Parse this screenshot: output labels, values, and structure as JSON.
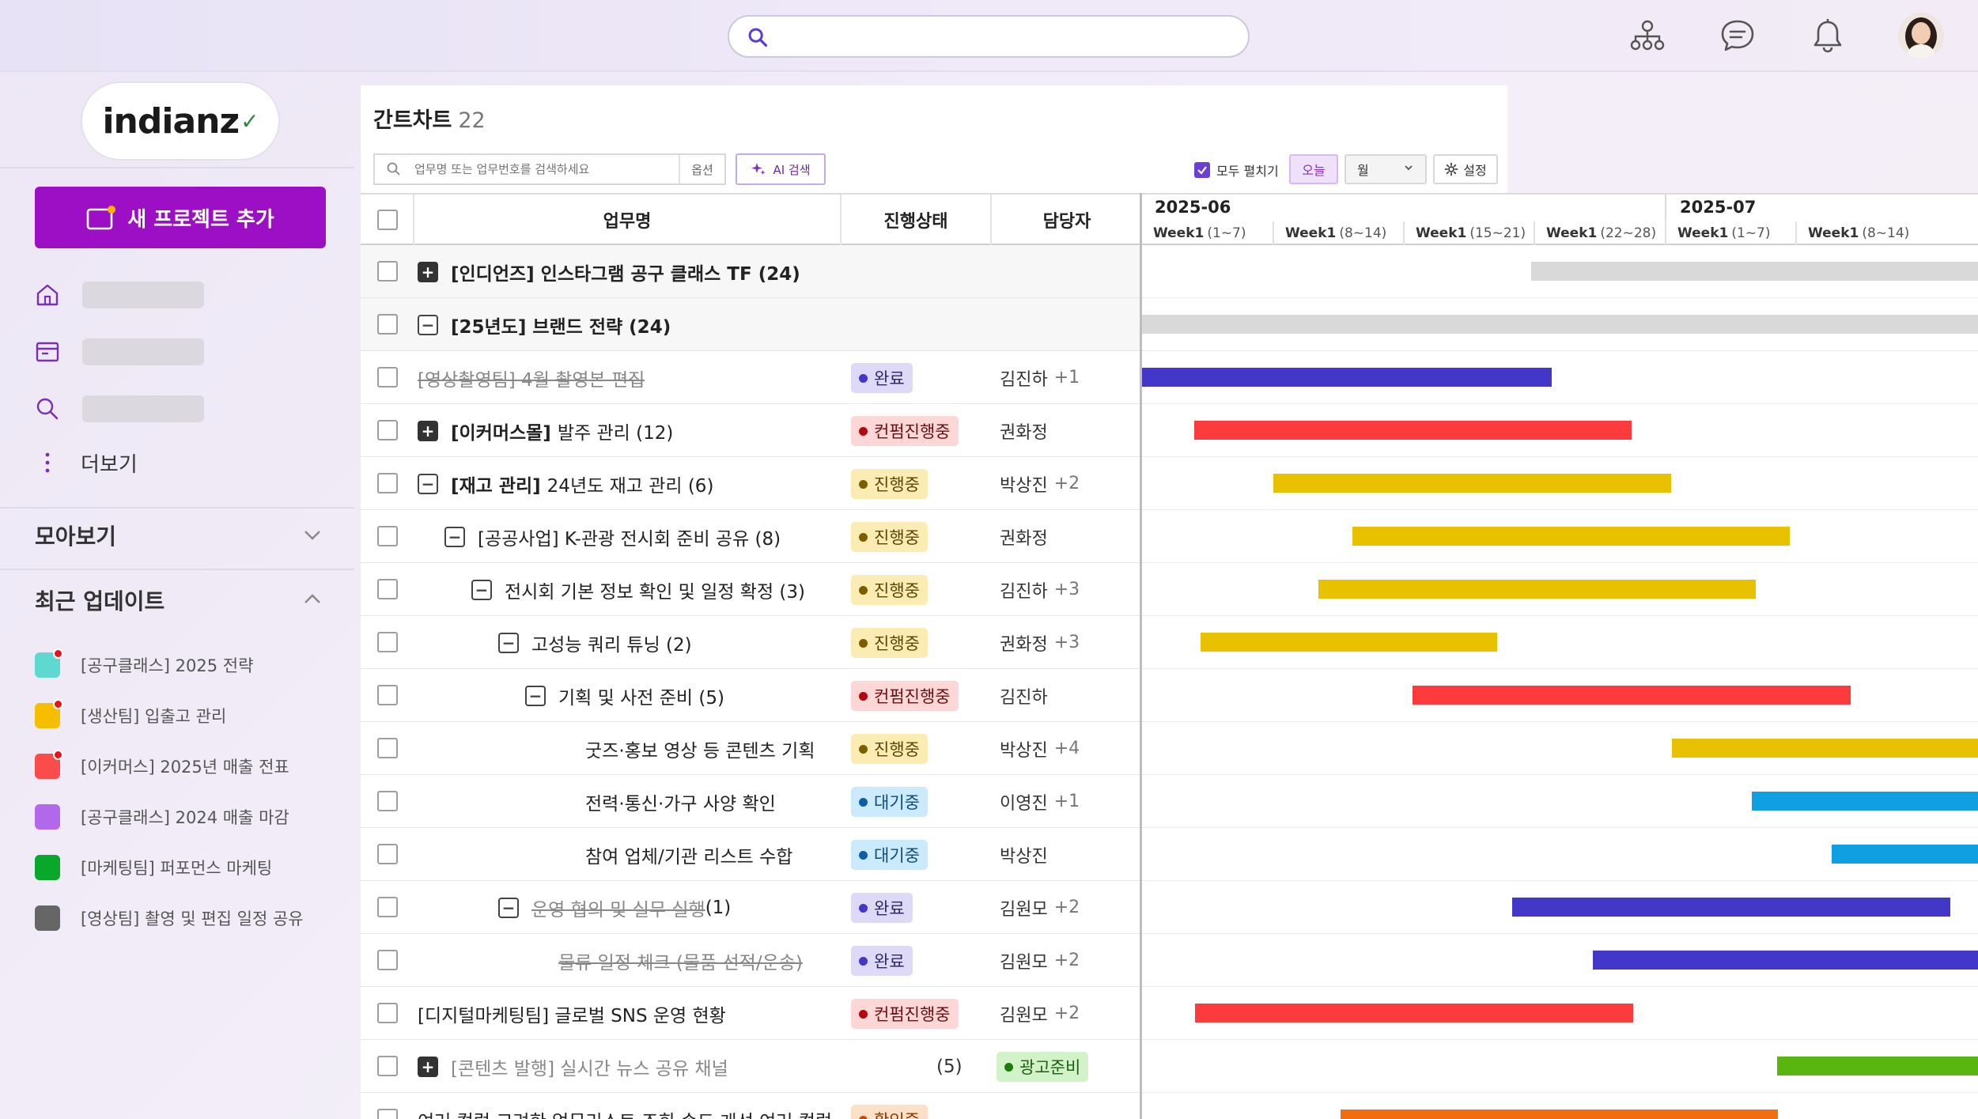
{
  "topbar": {
    "search_placeholder": "",
    "icons": [
      "search-icon",
      "org-chart-icon",
      "chat-icon",
      "bell-icon"
    ]
  },
  "sidebar": {
    "logo_text": "indianz",
    "new_project_label": "새 프로젝트 추가",
    "more_label": "더보기",
    "collect_label": "모아보기",
    "recent_label": "최근 업데이트",
    "recent_items": [
      {
        "label": "[공구클래스] 2025 전략",
        "color": "#5fd9cf",
        "badge": true
      },
      {
        "label": "[생산팀] 입출고 관리",
        "color": "#f5bf00",
        "badge": true
      },
      {
        "label": "[이커머스] 2025년 매출 전표",
        "color": "#fb4c4c",
        "badge": true
      },
      {
        "label": "[공구클래스] 2024 매출 마감",
        "color": "#b168ea",
        "badge": false
      },
      {
        "label": "[마케팅팀] 퍼포먼스 마케팅",
        "color": "#09a72a",
        "badge": false
      },
      {
        "label": "[영상팀] 촬영 및 편집 일정 공유",
        "color": "#666666",
        "badge": false
      }
    ]
  },
  "main": {
    "title": "간트차트",
    "count": "22",
    "filter_placeholder": "업무명 또는 업무번호를 검색하세요",
    "option_label": "옵션",
    "ai_label": "AI 검색",
    "expand_all_label": "모두 펼치기",
    "today_label": "오늘",
    "month_label": "월",
    "settings_label": "설정",
    "columns": {
      "name": "업무명",
      "status": "진행상태",
      "owner": "담당자"
    }
  },
  "rows": [
    {
      "indent": 0,
      "toggle": "+",
      "toggle_dark": true,
      "prefix": "[인디언즈]",
      "name": "인스타그램 공구 클래스 TF (24)",
      "bold_all": true,
      "group": true,
      "status": "",
      "owner": "",
      "extra": ""
    },
    {
      "indent": 0,
      "toggle": "−",
      "toggle_dark": false,
      "prefix": "[25년도]",
      "name": "브랜드 전략 (24)",
      "bold_all": true,
      "group": true,
      "status": "",
      "owner": "",
      "extra": ""
    },
    {
      "indent": 0,
      "toggle": "",
      "prefix": "",
      "name": "[영상촬영팀] 4월 촬영본 편집",
      "strike": true,
      "status": "완료",
      "owner": "김진하",
      "extra": "+1"
    },
    {
      "indent": 0,
      "toggle": "+",
      "toggle_dark": true,
      "prefix": "[이커머스몰]",
      "name": "발주 관리 (12)",
      "status": "컨펌진행중",
      "owner": "권화정",
      "extra": ""
    },
    {
      "indent": 0,
      "toggle": "−",
      "toggle_dark": false,
      "prefix": "[재고 관리]",
      "name": "24년도 재고 관리 (6)",
      "status": "진행중",
      "owner": "박상진",
      "extra": "+2"
    },
    {
      "indent": 1,
      "toggle": "−",
      "toggle_dark": false,
      "prefix": "",
      "name": "[공공사업] K-관광 전시회 준비 공유 (8)",
      "status": "진행중",
      "owner": "권화정",
      "extra": ""
    },
    {
      "indent": 2,
      "toggle": "−",
      "toggle_dark": false,
      "prefix": "",
      "name": "전시회 기본 정보 확인 및 일정 확정 (3)",
      "status": "진행중",
      "owner": "김진하",
      "extra": "+3"
    },
    {
      "indent": 3,
      "toggle": "−",
      "toggle_dark": false,
      "prefix": "",
      "name": "고성능 쿼리 튜닝 (2)",
      "status": "진행중",
      "owner": "권화정",
      "extra": "+3"
    },
    {
      "indent": 4,
      "toggle": "−",
      "toggle_dark": false,
      "prefix": "",
      "name": "기획 및 사전 준비 (5)",
      "status": "컨펌진행중",
      "owner": "김진하",
      "extra": ""
    },
    {
      "indent": 5,
      "toggle": "",
      "prefix": "",
      "name": "굿즈·홍보 영상 등 콘텐츠 기획",
      "status": "진행중",
      "owner": "박상진",
      "extra": "+4"
    },
    {
      "indent": 5,
      "toggle": "",
      "prefix": "",
      "name": "전력·통신·가구 사양 확인",
      "status": "대기중",
      "owner": "이영진",
      "extra": "+1"
    },
    {
      "indent": 5,
      "toggle": "",
      "prefix": "",
      "name": "참여 업체/기관 리스트 수합",
      "status": "대기중",
      "owner": "박상진",
      "extra": ""
    },
    {
      "indent": 3,
      "toggle": "−",
      "toggle_dark": false,
      "prefix": "",
      "name": "운영 협의 및 실무 실행",
      "name_tail": " (1)",
      "strike_part": true,
      "status": "완료",
      "owner": "김원모",
      "extra": "+2"
    },
    {
      "indent": 4,
      "toggle": "",
      "prefix": "",
      "name": "물류 일정 체크 (물품 선적/운송)",
      "strike": true,
      "status": "완료",
      "owner": "김원모",
      "extra": "+2"
    },
    {
      "indent": 0,
      "toggle": "",
      "prefix": "",
      "name": "[디지털마케팅팀] 글로벌 SNS 운영 현황",
      "status": "컨펌진행중",
      "owner": "김원모",
      "extra": "+2"
    },
    {
      "indent": 0,
      "toggle": "+",
      "toggle_dark": true,
      "prefix": "",
      "name": "[콘텐츠 발행] 실시간 뉴스 공유 채널",
      "grey": true,
      "count": "(5)",
      "status": "광고준비",
      "owner": "",
      "extra": ""
    },
    {
      "indent": 0,
      "toggle": "",
      "prefix": "",
      "name": "여러 컬럼 고려한 업무리스트 조회 속도 개선 여러 컬럼 고려한 업무리스…",
      "status": "확인중",
      "owner": "",
      "extra": ""
    }
  ],
  "status_styles": {
    "완료": {
      "bg": "#ded9f6",
      "dot": "#4237c9",
      "fg": "#2a2a6a"
    },
    "컨펌진행중": {
      "bg": "#fdd6d6",
      "dot": "#b5050f",
      "fg": "#6a1010"
    },
    "진행중": {
      "bg": "#fbecb4",
      "dot": "#7a5e00",
      "fg": "#5a4600"
    },
    "대기중": {
      "bg": "#cbeafb",
      "dot": "#0c5fa6",
      "fg": "#0c4a80"
    },
    "광고준비": {
      "bg": "#d2f3c7",
      "dot": "#1c7b0c",
      "fg": "#1e5e12"
    },
    "확인중": {
      "bg": "#fde0c8",
      "dot": "#c14b00",
      "fg": "#8a3b00"
    }
  },
  "gantt": {
    "months": [
      {
        "label": "2025-06"
      },
      {
        "label": "2025-07"
      }
    ],
    "weeks": [
      {
        "label": "Week1",
        "range": "(1~7)"
      },
      {
        "label": "Week1",
        "range": "(8~14)"
      },
      {
        "label": "Week1",
        "range": "(15~21)"
      },
      {
        "label": "Week1",
        "range": "(22~28)"
      },
      {
        "label": "Week1",
        "range": "(1~7)"
      },
      {
        "label": "Week1",
        "range": "(8~14)"
      }
    ],
    "bar_colors": {
      "grey": "#d9d9d9",
      "done": "#4237c9",
      "confirm": "#fd3a3c",
      "progress": "#e8c200",
      "wait": "#10a0e1",
      "ad": "#58b60f",
      "check": "#f26c10"
    },
    "bars": [
      {
        "color": "grey",
        "start": 0.465,
        "end": 1.0
      },
      {
        "color": "grey",
        "start": 0.0,
        "end": 1.0
      },
      {
        "color": "done",
        "start": 0.0,
        "end": 0.49
      },
      {
        "color": "confirm",
        "start": 0.062,
        "end": 0.585
      },
      {
        "color": "progress",
        "start": 0.157,
        "end": 0.633
      },
      {
        "color": "progress",
        "start": 0.252,
        "end": 0.775
      },
      {
        "color": "progress",
        "start": 0.211,
        "end": 0.734
      },
      {
        "color": "progress",
        "start": 0.07,
        "end": 0.425
      },
      {
        "color": "confirm",
        "start": 0.324,
        "end": 0.848
      },
      {
        "color": "progress",
        "start": 0.634,
        "end": 1.0
      },
      {
        "color": "wait",
        "start": 0.729,
        "end": 1.0
      },
      {
        "color": "wait",
        "start": 0.825,
        "end": 1.0
      },
      {
        "color": "done",
        "start": 0.443,
        "end": 0.967
      },
      {
        "color": "done",
        "start": 0.539,
        "end": 1.0
      },
      {
        "color": "confirm",
        "start": 0.063,
        "end": 0.587
      },
      {
        "color": "ad",
        "start": 0.76,
        "end": 1.0
      },
      {
        "color": "check",
        "start": 0.237,
        "end": 0.76
      }
    ]
  }
}
